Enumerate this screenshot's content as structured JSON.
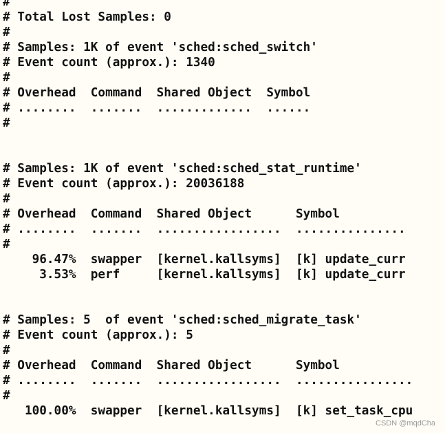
{
  "terminal": {
    "lines": [
      "#",
      "# Total Lost Samples: 0",
      "#",
      "# Samples: 1K of event 'sched:sched_switch'",
      "# Event count (approx.): 1340",
      "#",
      "# Overhead  Command  Shared Object  Symbol",
      "# ........  .......  .............  ......",
      "#",
      "",
      "",
      "# Samples: 1K of event 'sched:sched_stat_runtime'",
      "# Event count (approx.): 20036188",
      "#",
      "# Overhead  Command  Shared Object      Symbol",
      "# ........  .......  .................  ...............",
      "#",
      "    96.47%  swapper  [kernel.kallsyms]  [k] update_curr",
      "     3.53%  perf     [kernel.kallsyms]  [k] update_curr",
      "",
      "",
      "# Samples: 5  of event 'sched:sched_migrate_task'",
      "# Event count (approx.): 5",
      "#",
      "# Overhead  Command  Shared Object      Symbol",
      "# ........  .......  .................  ................",
      "#",
      "   100.00%  swapper  [kernel.kallsyms]  [k] set_task_cpu"
    ]
  },
  "watermark": "CSDN @mqdCha"
}
